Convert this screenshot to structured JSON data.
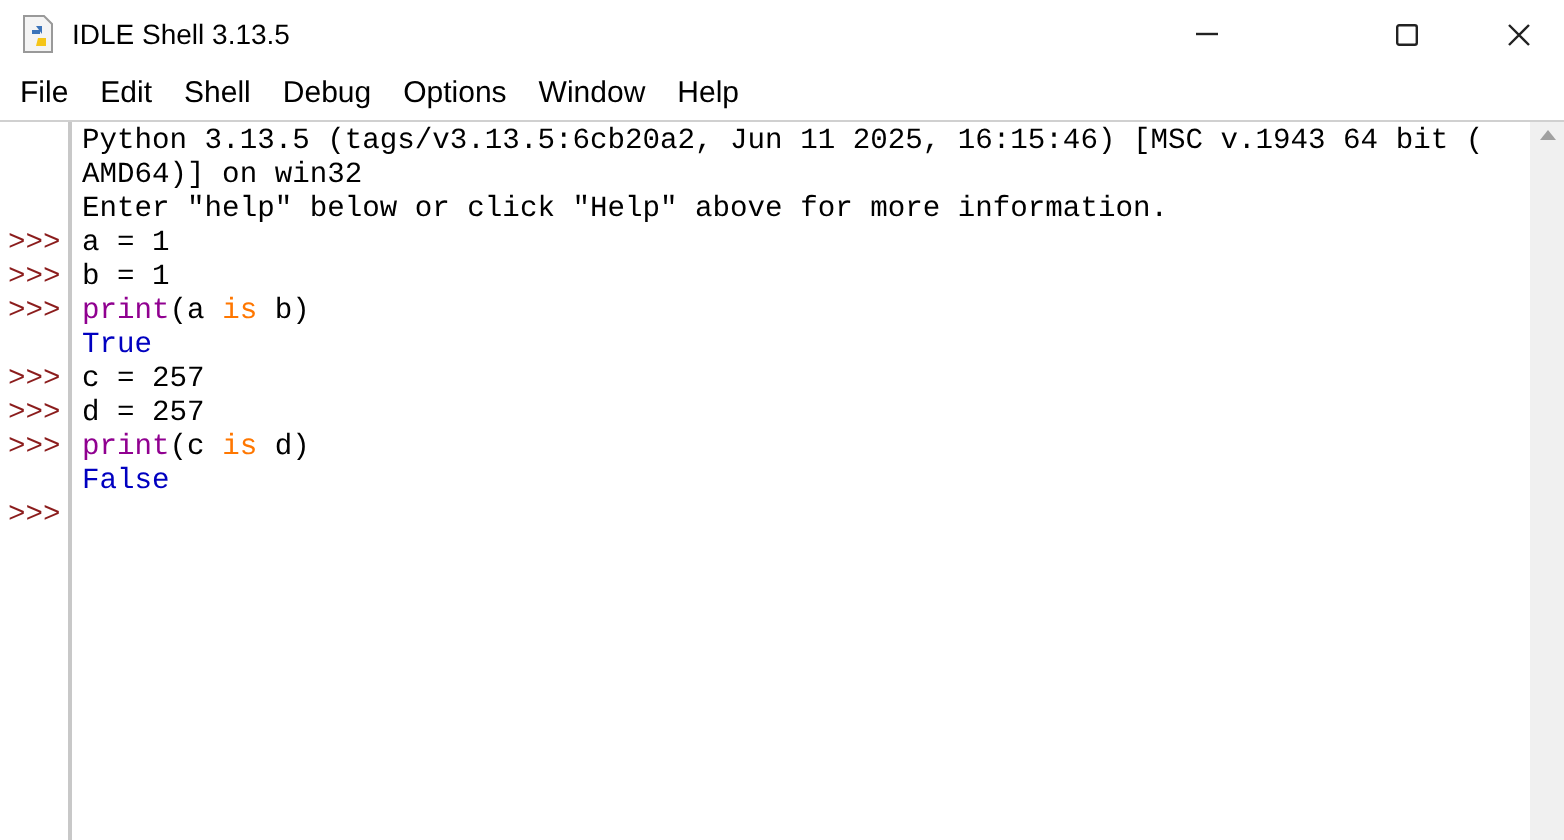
{
  "window": {
    "title": "IDLE Shell 3.13.5"
  },
  "menu": [
    {
      "label": "File"
    },
    {
      "label": "Edit"
    },
    {
      "label": "Shell"
    },
    {
      "label": "Debug"
    },
    {
      "label": "Options"
    },
    {
      "label": "Window"
    },
    {
      "label": "Help"
    }
  ],
  "shell": {
    "lines": [
      {
        "segments": [
          {
            "kind": "plain",
            "text": "Python 3.13.5 (tags/v3.13.5:6cb20a2, Jun 11 2025, 16:15:46) [MSC v.1943 64 bit ("
          }
        ]
      },
      {
        "segments": [
          {
            "kind": "plain",
            "text": "AMD64)] on win32"
          }
        ]
      },
      {
        "segments": [
          {
            "kind": "plain",
            "text": "Enter \"help\" below or click \"Help\" above for more information."
          }
        ]
      },
      {
        "prompt": ">>>",
        "segments": [
          {
            "kind": "plain",
            "text": "a = 1"
          }
        ]
      },
      {
        "prompt": ">>>",
        "segments": [
          {
            "kind": "plain",
            "text": "b = 1"
          }
        ]
      },
      {
        "prompt": ">>>",
        "segments": [
          {
            "kind": "builtin",
            "text": "print"
          },
          {
            "kind": "plain",
            "text": "(a "
          },
          {
            "kind": "keyword",
            "text": "is"
          },
          {
            "kind": "plain",
            "text": " b)"
          }
        ]
      },
      {
        "segments": [
          {
            "kind": "output",
            "text": "True"
          }
        ]
      },
      {
        "prompt": ">>>",
        "segments": [
          {
            "kind": "plain",
            "text": "c = 257"
          }
        ]
      },
      {
        "prompt": ">>>",
        "segments": [
          {
            "kind": "plain",
            "text": "d = 257"
          }
        ]
      },
      {
        "prompt": ">>>",
        "segments": [
          {
            "kind": "builtin",
            "text": "print"
          },
          {
            "kind": "plain",
            "text": "(c "
          },
          {
            "kind": "keyword",
            "text": "is"
          },
          {
            "kind": "plain",
            "text": " d)"
          }
        ]
      },
      {
        "segments": [
          {
            "kind": "output",
            "text": "False"
          }
        ]
      },
      {
        "prompt": ">>>"
      }
    ]
  }
}
